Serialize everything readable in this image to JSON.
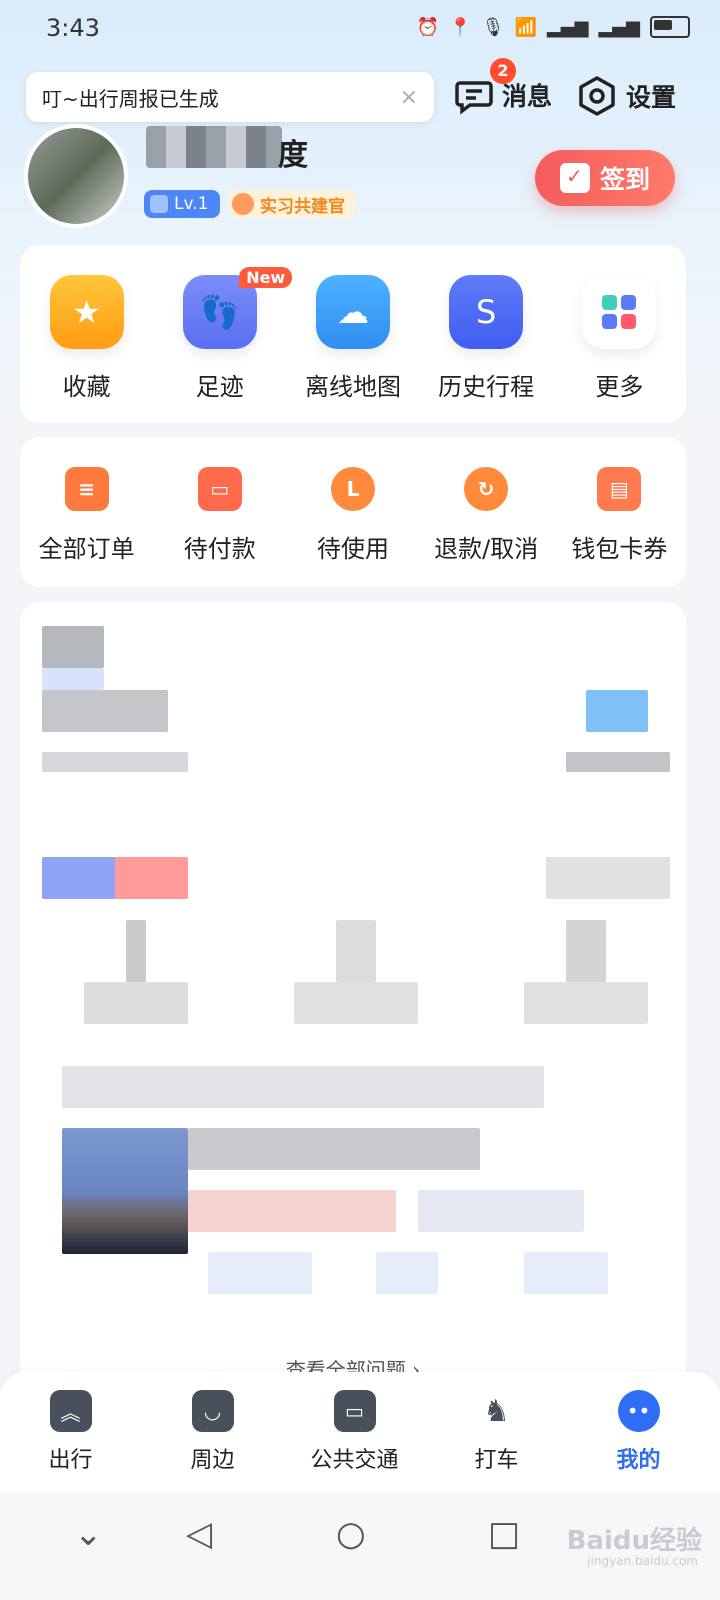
{
  "status_bar": {
    "time": "3:43",
    "icons": [
      "alarm-icon",
      "location-icon",
      "mic-icon",
      "wifi-icon",
      "4g-signal-icon",
      "4g-signal-icon",
      "battery-icon"
    ]
  },
  "toast": {
    "text": "叮~出行周报已生成",
    "close": "×"
  },
  "header": {
    "messages_label": "消息",
    "messages_badge": "2",
    "settings_label": "设置"
  },
  "profile": {
    "name_visible_char": "度",
    "level": "Lv.1",
    "tag": "实习共建官",
    "signin_label": "签到"
  },
  "quick_actions": [
    {
      "label": "收藏",
      "icon": "star-icon",
      "color": "#ffb21f"
    },
    {
      "label": "足迹",
      "icon": "footprint-icon",
      "color": "#5a78f5",
      "badge": "New"
    },
    {
      "label": "离线地图",
      "icon": "cloud-download-icon",
      "color": "#3c9bf5"
    },
    {
      "label": "历史行程",
      "icon": "route-icon",
      "color": "#4c6bf2"
    },
    {
      "label": "更多",
      "icon": "grid-icon",
      "color": "#ffffff"
    }
  ],
  "orders": [
    {
      "label": "全部订单",
      "icon": "order-icon",
      "color": "#ff7a3c"
    },
    {
      "label": "待付款",
      "icon": "card-icon",
      "color": "#ff6a4c"
    },
    {
      "label": "待使用",
      "icon": "clock-icon",
      "color": "#ff8a3c"
    },
    {
      "label": "退款/取消",
      "icon": "refresh-icon",
      "color": "#ff8a3c"
    },
    {
      "label": "钱包卡券",
      "icon": "wallet-icon",
      "color": "#ff7a4c"
    }
  ],
  "content": {
    "view_all": "查看全部问题 ›"
  },
  "bottom_nav": [
    {
      "label": "出行",
      "icon": "travel-icon",
      "active": false
    },
    {
      "label": "周边",
      "icon": "nearby-icon",
      "active": false
    },
    {
      "label": "公共交通",
      "icon": "bus-icon",
      "active": false
    },
    {
      "label": "打车",
      "icon": "taxi-icon",
      "active": false
    },
    {
      "label": "我的",
      "icon": "profile-icon",
      "active": true
    }
  ],
  "system_nav": {
    "watermark": "Baidu经验",
    "watermark_sub": "jingyan.baidu.com"
  }
}
